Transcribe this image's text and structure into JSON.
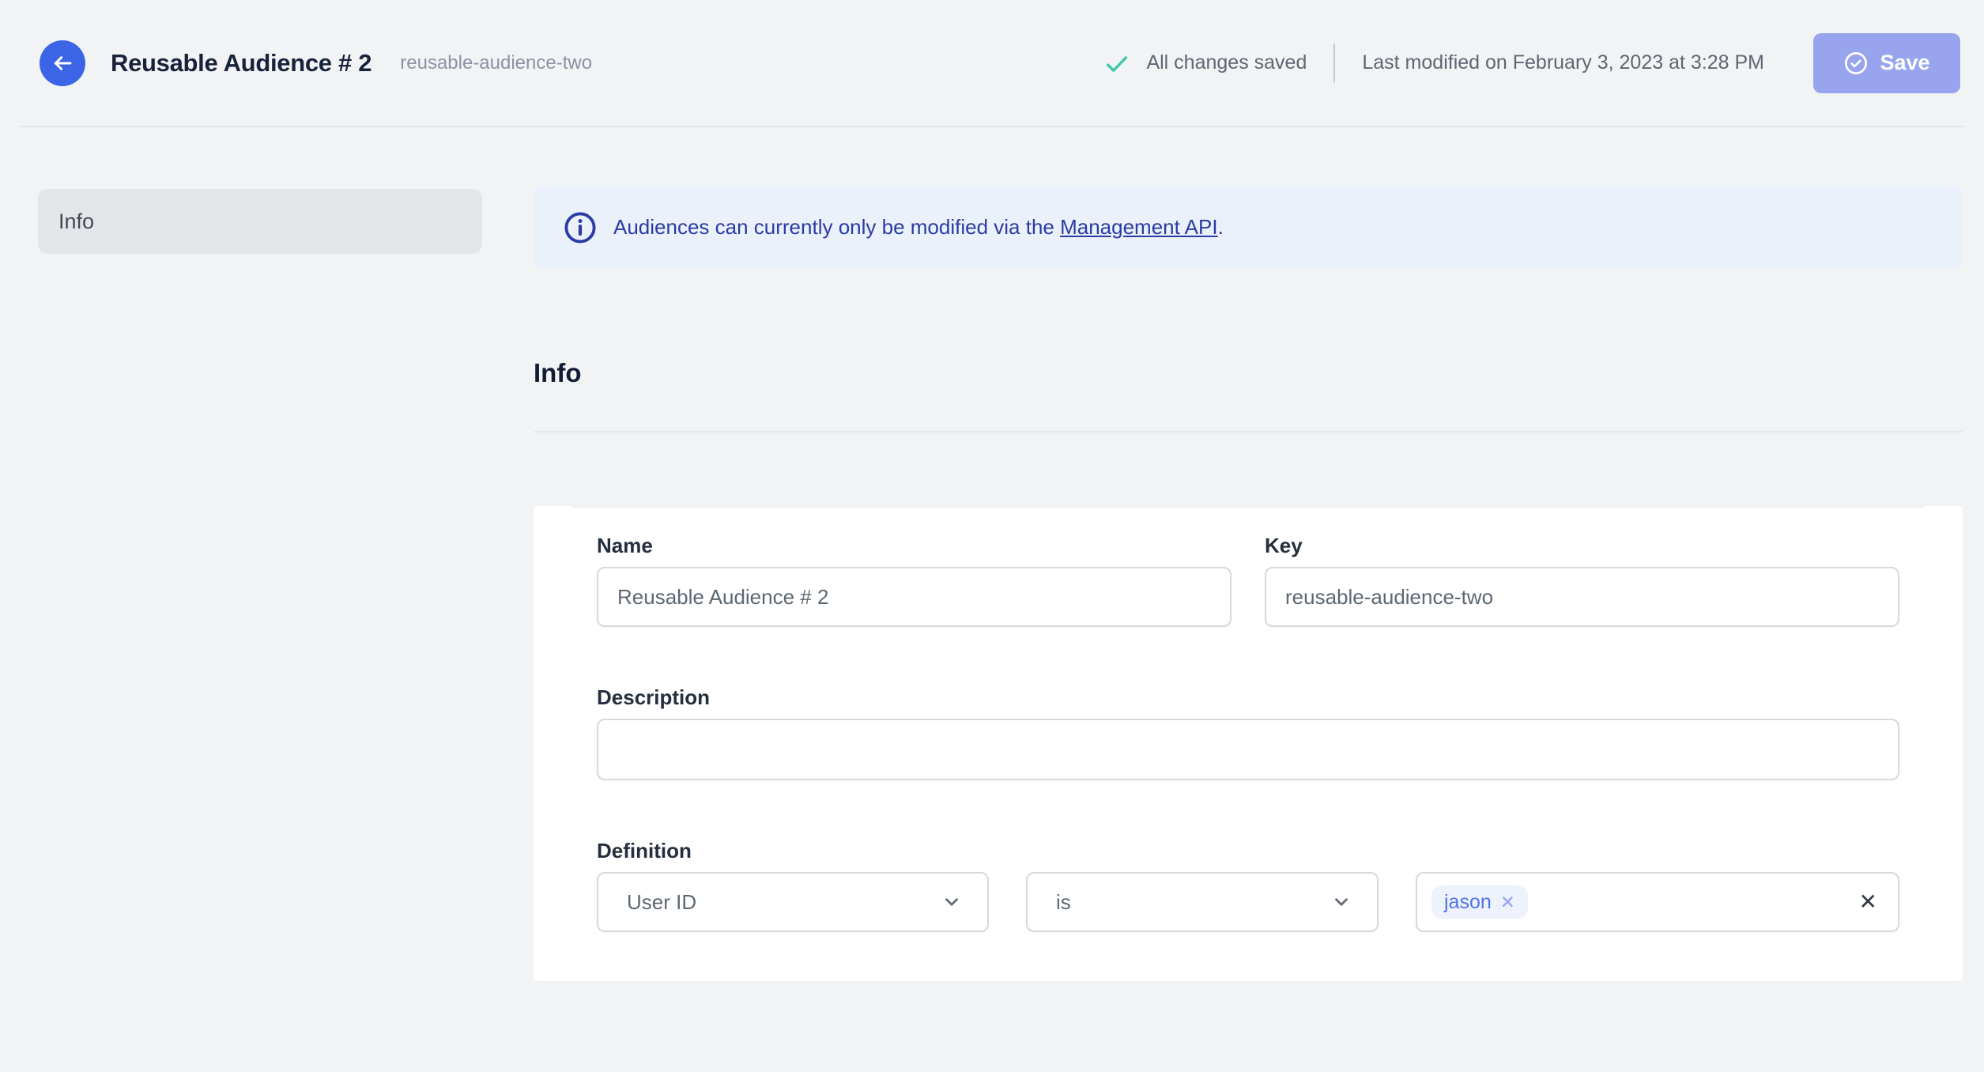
{
  "header": {
    "title": "Reusable Audience # 2",
    "slug": "reusable-audience-two",
    "save_status": "All changes saved",
    "last_modified": "Last modified on February 3, 2023 at 3:28 PM",
    "save_label": "Save"
  },
  "sidebar": {
    "items": [
      {
        "label": "Info",
        "active": true
      }
    ]
  },
  "banner": {
    "text_before_link": "Audiences can currently only be modified via the ",
    "link_text": "Management API",
    "text_after_link": "."
  },
  "section": {
    "title": "Info"
  },
  "form": {
    "name": {
      "label": "Name",
      "value": "Reusable Audience # 2"
    },
    "key": {
      "label": "Key",
      "value": "reusable-audience-two"
    },
    "description": {
      "label": "Description",
      "value": "",
      "placeholder": ""
    },
    "definition": {
      "label": "Definition",
      "trait_selected": "User ID",
      "operator_selected": "is",
      "values": [
        {
          "label": "jason"
        }
      ]
    }
  },
  "icons": {
    "back": "arrow-left",
    "saved": "check",
    "save": "circle-check",
    "banner": "info-circle",
    "dropdown": "chevron-down",
    "remove_glyph": "✕",
    "clear_glyph": "✕"
  },
  "colors": {
    "accent_blue": "#3b64e6",
    "save_disabled": "#98a5ee",
    "banner_bg": "#eaf1fb",
    "banner_text": "#2b3ba3",
    "success_green": "#43c7a9",
    "chip_bg": "#edf2fd",
    "chip_text": "#5173e8",
    "page_bg": "#f2f3f5"
  }
}
